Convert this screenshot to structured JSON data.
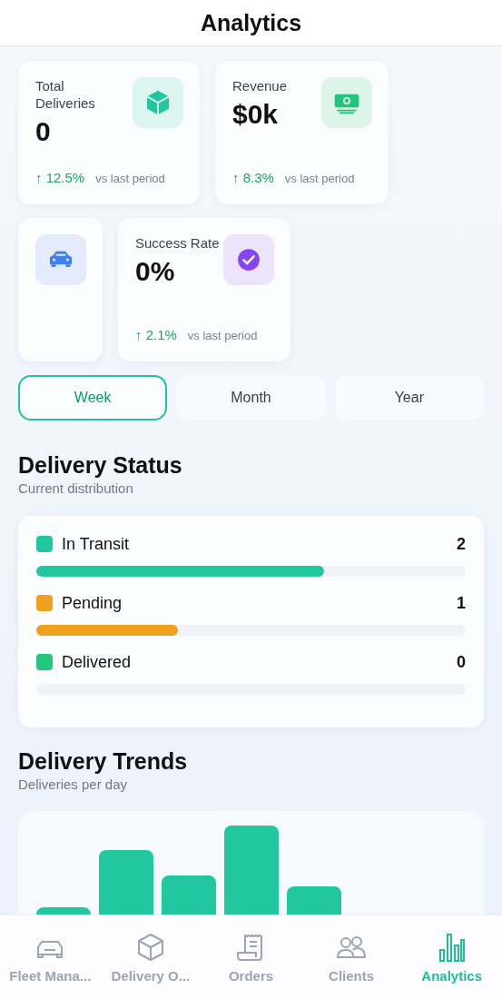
{
  "header": {
    "title": "Analytics"
  },
  "stats": [
    {
      "label": "Total Deliveries",
      "value": "0",
      "change": "↑ 12.5%",
      "note": "vs last period",
      "kind": "cube"
    },
    {
      "label": "Revenue",
      "value": "$0k",
      "change": "↑ 8.3%",
      "note": "vs last period",
      "kind": "money"
    },
    {
      "kind": "car"
    },
    {
      "label": "Success Rate",
      "value": "0%",
      "change": "↑ 2.1%",
      "note": "vs last period",
      "kind": "check"
    }
  ],
  "periods": [
    {
      "label": "Week",
      "selected": true
    },
    {
      "label": "Month",
      "selected": false
    },
    {
      "label": "Year",
      "selected": false
    }
  ],
  "status": {
    "title": "Delivery Status",
    "subtitle": "Current distribution",
    "items": [
      {
        "label": "In Transit",
        "count": "2",
        "level": 0.67,
        "color": "#22c7a0"
      },
      {
        "label": "Pending",
        "count": "1",
        "level": 0.33,
        "color": "#f0a01c"
      },
      {
        "label": "Delivered",
        "count": "0",
        "level": 0,
        "color": "#22c77a"
      }
    ]
  },
  "trends": {
    "title": "Delivery Trends",
    "subtitle": "Deliveries per day"
  },
  "tabbar": [
    {
      "label": "Fleet Mana...",
      "kind": "car",
      "selected": false
    },
    {
      "label": "Delivery O...",
      "kind": "cube",
      "selected": false
    },
    {
      "label": "Orders",
      "kind": "receipt",
      "selected": false
    },
    {
      "label": "Clients",
      "kind": "people",
      "selected": false
    },
    {
      "label": "Analytics",
      "kind": "bars",
      "selected": true
    }
  ]
}
